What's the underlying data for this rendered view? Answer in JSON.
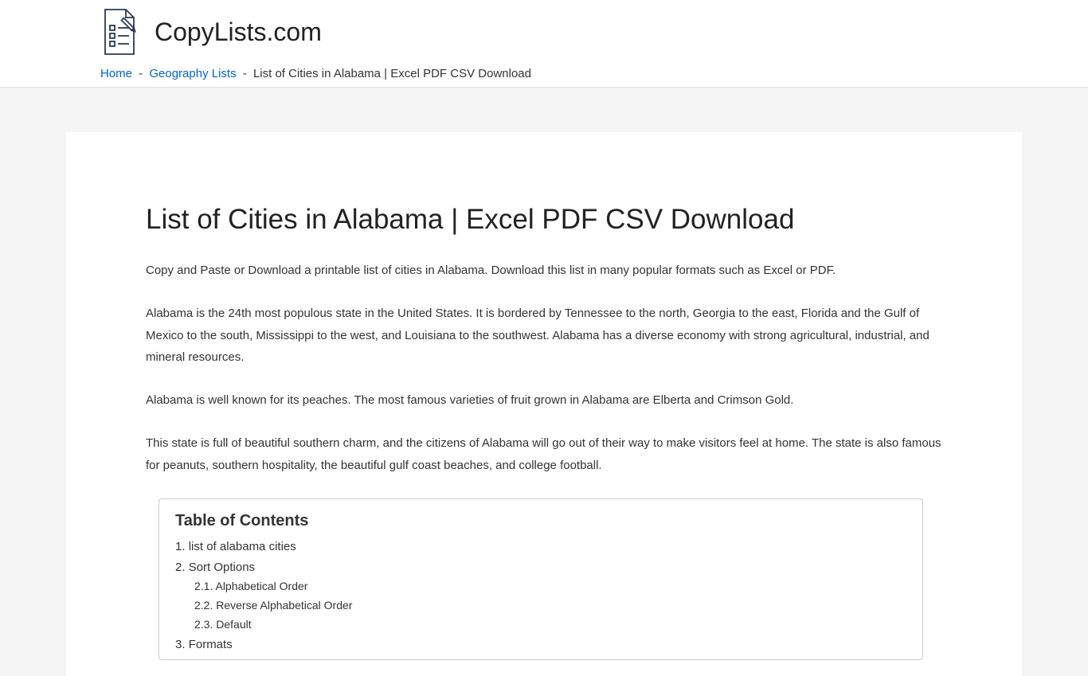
{
  "header": {
    "site_title": "CopyLists.com"
  },
  "breadcrumb": {
    "home": "Home",
    "category": "Geography Lists",
    "sep": " - ",
    "current": "List of Cities in Alabama | Excel PDF CSV Download"
  },
  "page": {
    "title": "List of Cities in Alabama | Excel PDF CSV Download",
    "para1": "Copy and Paste or Download a printable list of cities in Alabama. Download this list in many popular formats such as Excel or PDF.",
    "para2": "Alabama is the 24th most populous state in the United States. It is bordered by Tennessee to the north, Georgia to the east, Florida and the Gulf of Mexico to the south, Mississippi to the west, and Louisiana to the southwest. Alabama has a diverse economy with strong agricultural, industrial, and mineral resources.",
    "para3": "Alabama is well known for its peaches. The most famous varieties of fruit grown in Alabama are Elberta and Crimson Gold.",
    "para4": "This state is full of beautiful southern charm, and the citizens of Alabama will go out of their way to make visitors feel at home. The state is also famous for peanuts, southern hospitality, the beautiful gulf coast beaches, and college football."
  },
  "toc": {
    "title": "Table of Contents",
    "items": [
      {
        "level": 1,
        "num": "1.",
        "label": "list of alabama cities"
      },
      {
        "level": 1,
        "num": "2.",
        "label": "Sort Options"
      },
      {
        "level": 2,
        "num": "2.1.",
        "label": "Alphabetical Order"
      },
      {
        "level": 2,
        "num": "2.2.",
        "label": " Reverse Alphabetical Order"
      },
      {
        "level": 2,
        "num": "2.3.",
        "label": "Default"
      },
      {
        "level": 1,
        "num": "3.",
        "label": "Formats"
      }
    ]
  }
}
